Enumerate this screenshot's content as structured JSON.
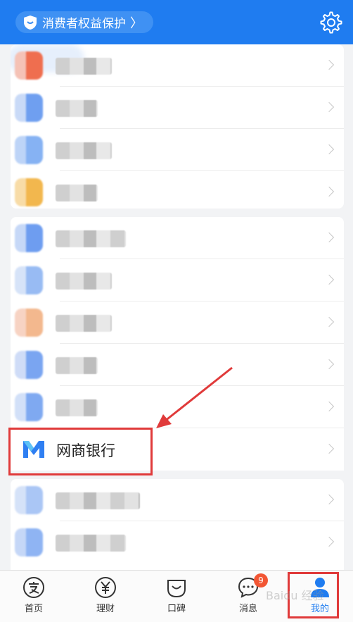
{
  "header": {
    "consumer_protection": "消费者权益保护",
    "arrow": "〉"
  },
  "bank_item": {
    "label": "网商银行"
  },
  "tabs": [
    {
      "label": "首页",
      "icon": "alipay-icon"
    },
    {
      "label": "理财",
      "icon": "yen-icon"
    },
    {
      "label": "口碑",
      "icon": "koubei-icon"
    },
    {
      "label": "消息",
      "icon": "message-icon",
      "badge": "9"
    },
    {
      "label": "我的",
      "icon": "user-icon",
      "active": true
    }
  ],
  "watermark": "Baidu 经验",
  "colors": {
    "brand": "#1f7cf0",
    "highlight": "#e03a3a",
    "badge": "#f25634"
  }
}
